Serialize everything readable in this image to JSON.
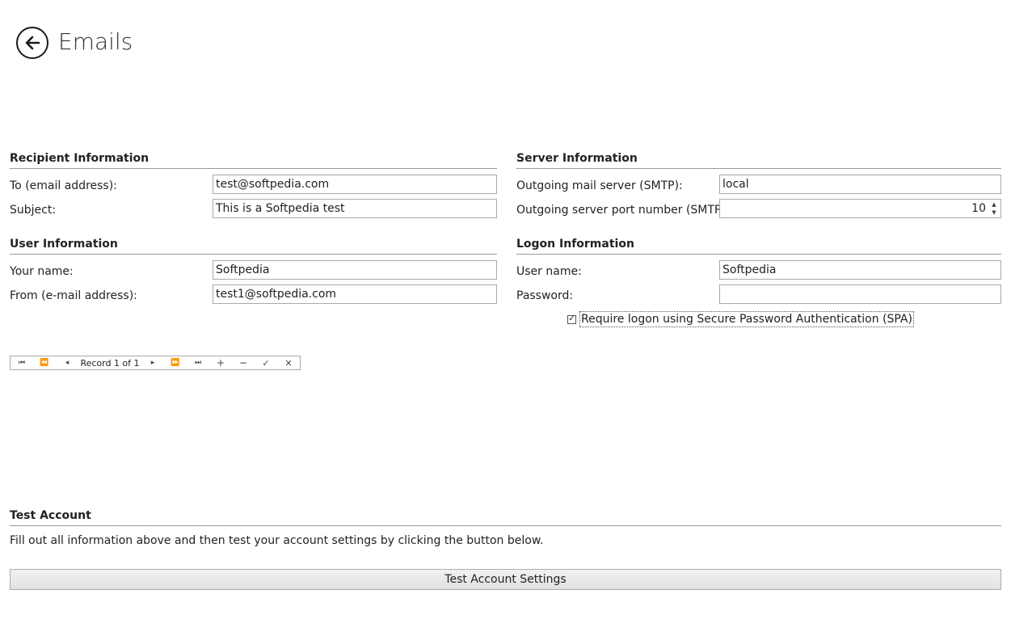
{
  "header": {
    "title": "Emails",
    "back_icon": "arrow-left-icon"
  },
  "recipient": {
    "title": "Recipient Information",
    "to_label": "To (email address):",
    "to_value": "test@softpedia.com",
    "subject_label": "Subject:",
    "subject_value": "This is a Softpedia test"
  },
  "user": {
    "title": "User Information",
    "name_label": "Your name:",
    "name_value": "Softpedia",
    "from_label": "From (e-mail address):",
    "from_value": "test1@softpedia.com"
  },
  "server": {
    "title": "Server Information",
    "smtp_label": "Outgoing mail server (SMTP):",
    "smtp_value": "local",
    "port_label": "Outgoing server port number (SMTP):",
    "port_value": "10"
  },
  "logon": {
    "title": "Logon Information",
    "username_label": "User name:",
    "username_value": "Softpedia",
    "password_label": "Password:",
    "password_value": "",
    "spa_label": "Require logon using Secure Password Authentication (SPA)",
    "spa_checked": true
  },
  "navigator": {
    "record_text": "Record 1 of 1",
    "first": "⏮",
    "prev_page": "⏪",
    "prev": "◂",
    "next": "▸",
    "next_page": "⏩",
    "last": "⏭",
    "add": "+",
    "remove": "−",
    "apply": "✓",
    "cancel": "✕"
  },
  "test": {
    "title": "Test Account",
    "description": "Fill out all information above and then test your account settings by clicking the button below.",
    "button_label": "Test Account Settings"
  }
}
